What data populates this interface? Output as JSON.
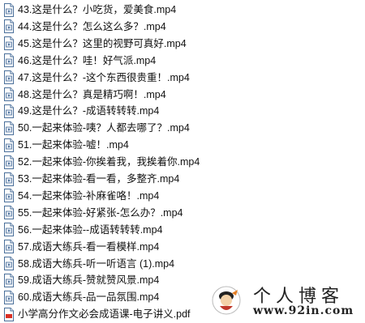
{
  "files": [
    {
      "name": "43.这是什么？小吃货，爱美食.mp4",
      "icon": "video-file-icon"
    },
    {
      "name": "44.这是什么？怎么这么多？.mp4",
      "icon": "video-file-icon"
    },
    {
      "name": "45.这是什么？这里的视野可真好.mp4",
      "icon": "video-file-icon"
    },
    {
      "name": "46.这是什么？哇！好气派.mp4",
      "icon": "video-file-icon"
    },
    {
      "name": "47.这是什么？-这个东西很贵重！.mp4",
      "icon": "video-file-icon"
    },
    {
      "name": "48.这是什么？真是精巧啊！.mp4",
      "icon": "video-file-icon"
    },
    {
      "name": "49.这是什么？-成语转转转.mp4",
      "icon": "video-file-icon"
    },
    {
      "name": "50.一起来体验-咦？人都去哪了？.mp4",
      "icon": "video-file-icon"
    },
    {
      "name": "51.一起来体验-嘘！.mp4",
      "icon": "video-file-icon"
    },
    {
      "name": "52.一起来体验-你挨着我，我挨着你.mp4",
      "icon": "video-file-icon"
    },
    {
      "name": "53.一起来体验-看一看，多整齐.mp4",
      "icon": "video-file-icon"
    },
    {
      "name": "54.一起来体验-补麻雀咯！.mp4",
      "icon": "video-file-icon"
    },
    {
      "name": "55.一起来体验-好紧张-怎么办？.mp4",
      "icon": "video-file-icon"
    },
    {
      "name": "56.一起来体验--成语转转转.mp4",
      "icon": "video-file-icon"
    },
    {
      "name": "57.成语大练兵-看一看模样.mp4",
      "icon": "video-file-icon"
    },
    {
      "name": "58.成语大练兵-听一听语言 (1).mp4",
      "icon": "video-file-icon"
    },
    {
      "name": "59.成语大练兵-赞就赞风景.mp4",
      "icon": "video-file-icon"
    },
    {
      "name": "60.成语大练兵-品一品氛围.mp4",
      "icon": "video-file-icon"
    },
    {
      "name": "小学高分作文必会成语课-电子讲义.pdf",
      "icon": "pdf-file-icon"
    }
  ],
  "watermark": {
    "title": "个人博客",
    "url": "www.92in.com"
  },
  "colors": {
    "pdf_accent": "#d93025",
    "icon_outline": "#4a6f9a"
  }
}
